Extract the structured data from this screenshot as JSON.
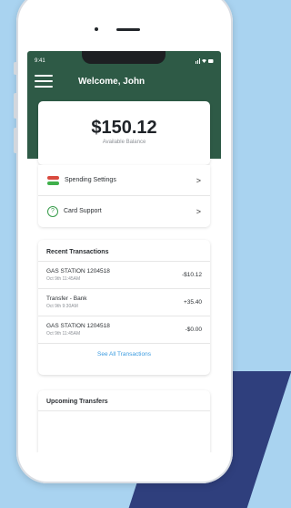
{
  "status_bar": {
    "time": "9:41",
    "icons": "signal-wifi-battery"
  },
  "header": {
    "welcome": "Welcome, John"
  },
  "balance": {
    "amount": "$150.12",
    "label": "Available Balance"
  },
  "menu": [
    {
      "label": "Spending Settings",
      "icon": "toggle-icon"
    },
    {
      "label": "Card Support",
      "icon": "question-circle-icon"
    }
  ],
  "transactions": {
    "title": "Recent Transactions",
    "items": [
      {
        "name": "GAS STATION 1204518",
        "date": "Oct 9th 11:45AM",
        "amount": "-$10.12"
      },
      {
        "name": "Transfer - Bank",
        "date": "Oct 9th 9:30AM",
        "amount": "+35.40"
      },
      {
        "name": "GAS STATION 1204518",
        "date": "Oct 9th 11:45AM",
        "amount": "-$0.00"
      }
    ],
    "see_all": "See All Transactions"
  },
  "upcoming": {
    "title": "Upcoming Transfers"
  },
  "colors": {
    "header": "#2e5a46",
    "accent_link": "#3b9be0",
    "background": "#a9d3f0"
  }
}
